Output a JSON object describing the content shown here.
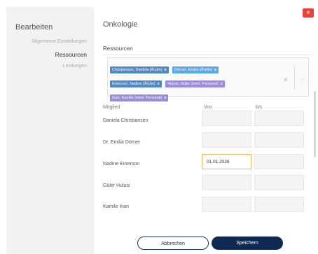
{
  "sidebar": {
    "title": "Bearbeiten",
    "items": [
      {
        "label": "Allgemeine Einstellungen"
      },
      {
        "label": "Ressourcen"
      },
      {
        "label": "Leistungen"
      }
    ]
  },
  "main": {
    "title": "Onkologie",
    "section": "Ressourcen"
  },
  "multiselect": {
    "tags": [
      {
        "label": "Christiansen, Daniela (Ärztin)",
        "x": "x"
      },
      {
        "label": "Dörner, Emilia (Ärztin)",
        "x": "x"
      },
      {
        "label": "Emerson, Nadine (Ärztin)",
        "x": "x"
      },
      {
        "label": "Hulusi, Güler (med. Personal)",
        "x": "x"
      },
      {
        "label": "Inan, Kamile (med. Personal)",
        "x": "x"
      }
    ],
    "clear_icon": "x",
    "chevron_icon": "chevron-down"
  },
  "table": {
    "headers": {
      "member": "Mitglied",
      "from": "Von",
      "to": "bis"
    },
    "rows": [
      {
        "name": "Daniela Christiansen",
        "from": "",
        "to": ""
      },
      {
        "name": "Dr. Emilia Dörner",
        "from": "",
        "to": ""
      },
      {
        "name": "Nadine Emerson",
        "from": "01.01.2026",
        "to": ""
      },
      {
        "name": "Güler Hulusi",
        "from": "",
        "to": ""
      },
      {
        "name": "Kamile Inan",
        "from": "",
        "to": ""
      }
    ]
  },
  "buttons": {
    "cancel": "Abbrechen",
    "save": "Speichern",
    "close": "×"
  },
  "colors": {
    "tag_blue": "#4f88c6",
    "tag_light": "#58a8ea",
    "tag_purple": "#9a8be0",
    "primary": "#0f2a52",
    "close": "#e8423a",
    "focus": "#f0b45a"
  }
}
